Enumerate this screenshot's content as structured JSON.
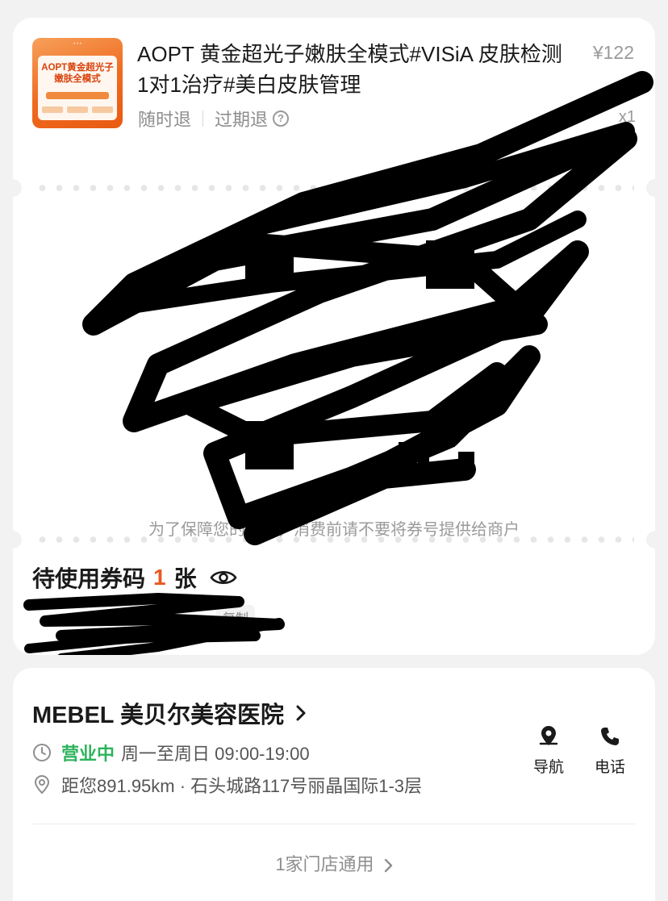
{
  "product": {
    "thumbnail_text": "AOPT黄金超光子嫩肤全模式",
    "title": "AOPT 黄金超光子嫩肤全模式#VISiA 皮肤检测1对1治疗#美白皮肤管理",
    "price": "¥122",
    "quantity": "x1",
    "tags": [
      "随时退",
      "过期退"
    ],
    "help_icon": "question-circle-icon"
  },
  "voucher": {
    "qr_tip": "为了保障您的权益，消费前请不要将券号提供给商户",
    "pending_prefix": "待使用券码",
    "pending_count": "1",
    "pending_suffix": "张",
    "visibility_icon": "eye-icon",
    "copy_label": "复制"
  },
  "shop": {
    "name": "MEBEL 美贝尔美容医院",
    "status": "营业中",
    "hours": "周一至周日 09:00-19:00",
    "address": "距您891.95km · 石头城路117号丽晶国际1-3层",
    "actions": [
      {
        "label": "导航",
        "icon": "location-pin-icon"
      },
      {
        "label": "电话",
        "icon": "phone-icon"
      }
    ],
    "stores_label": "1家门店通用"
  },
  "colors": {
    "accent": "#e85a21",
    "open_status": "#2db35b"
  }
}
